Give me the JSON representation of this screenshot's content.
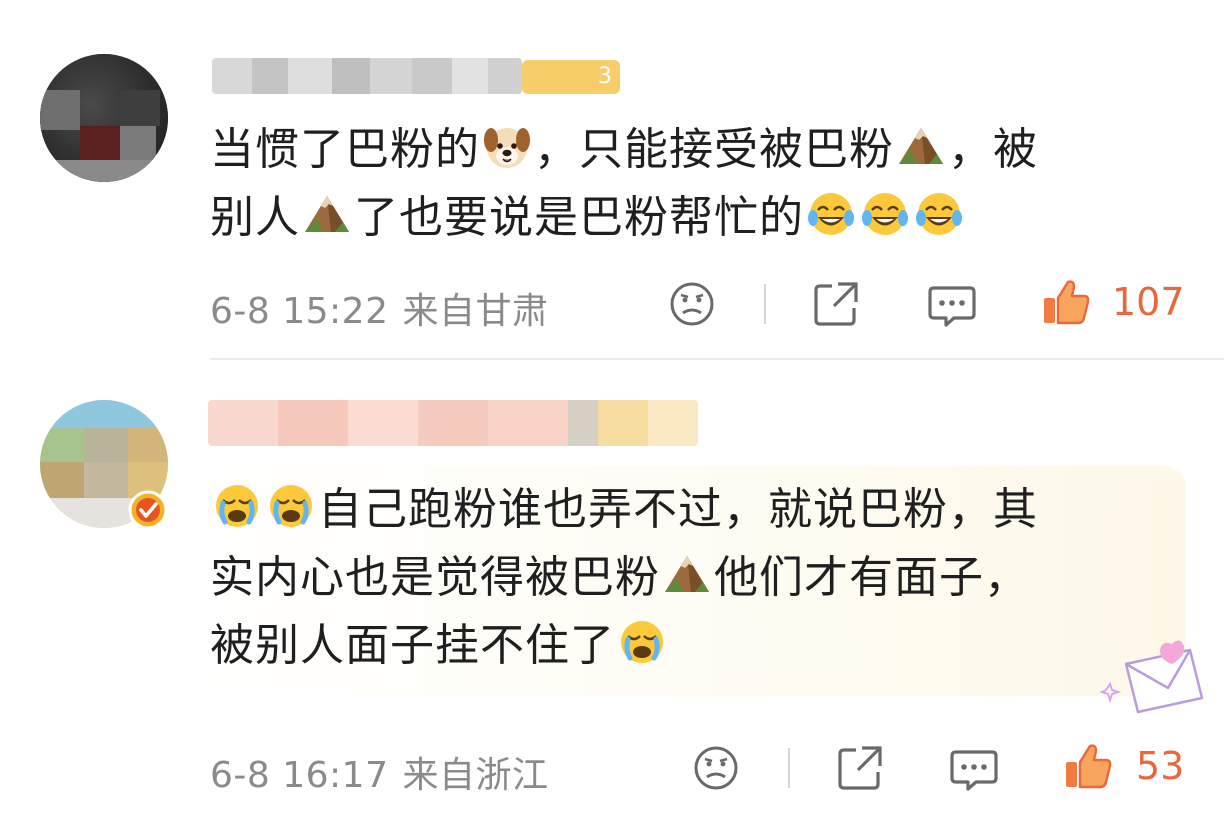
{
  "comments": [
    {
      "text_parts": [
        "当惯了巴粉的",
        "，只能接受被巴粉",
        "，被别人",
        "了也要说是巴粉帮忙的"
      ],
      "line1_a": "当惯了巴粉的",
      "line1_b": "，只能接受被巴粉",
      "line1_c": "，被",
      "line2_a": "别人",
      "line2_b": "了也要说是巴粉帮忙的",
      "timestamp": "6-8 15:22",
      "location": "来自甘肃",
      "likes": "107",
      "badge_level": "3",
      "icons": [
        "dog-face-emoji",
        "mountain-emoji",
        "laughing-tears-emoji"
      ]
    },
    {
      "line1": "自己跑粉谁也弄不过，就说巴粉，其",
      "line2_a": "实内心也是觉得被巴粉",
      "line2_b": "他们才有面子，",
      "line3": "被别人面子挂不住了",
      "timestamp": "6-8 16:17",
      "location": "来自浙江",
      "likes": "53",
      "icons": [
        "crying-emoji",
        "mountain-emoji",
        "verified-badge-icon"
      ]
    }
  ],
  "colors": {
    "like": "#e8673b",
    "meta": "#8a8a8a",
    "badge": "#f7cd6a"
  }
}
